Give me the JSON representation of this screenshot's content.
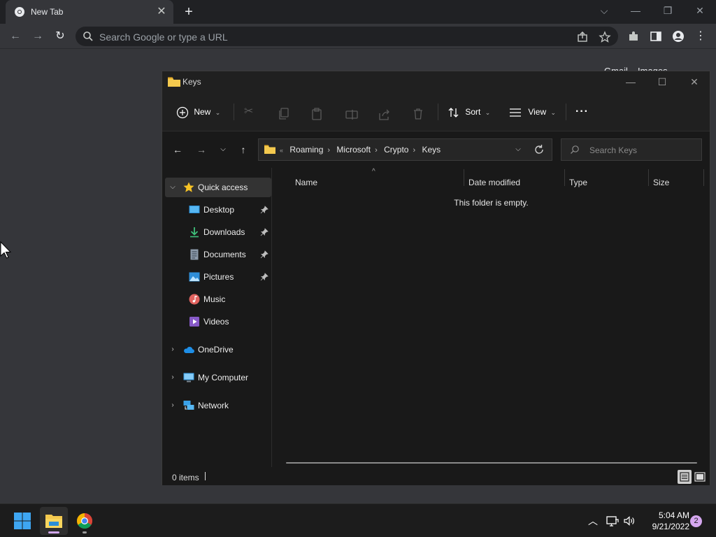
{
  "browser": {
    "tab_title": "New Tab",
    "omnibox_placeholder": "Search Google or type a URL",
    "ntp_links": [
      "Gmail",
      "Images"
    ]
  },
  "explorer": {
    "window_title": "Keys",
    "commands": {
      "new_label": "New",
      "sort_label": "Sort",
      "view_label": "View",
      "more_label": "···"
    },
    "breadcrumb": [
      "Roaming",
      "Microsoft",
      "Crypto",
      "Keys"
    ],
    "breadcrumb_overflow": "«",
    "search_placeholder": "Search Keys",
    "nav": {
      "quick_access": "Quick access",
      "items": [
        {
          "label": "Desktop",
          "pinned": true
        },
        {
          "label": "Downloads",
          "pinned": true
        },
        {
          "label": "Documents",
          "pinned": true
        },
        {
          "label": "Pictures",
          "pinned": true
        },
        {
          "label": "Music",
          "pinned": false
        },
        {
          "label": "Videos",
          "pinned": false
        }
      ],
      "onedrive": "OneDrive",
      "my_computer": "My Computer",
      "network": "Network"
    },
    "columns": [
      "Name",
      "Date modified",
      "Type",
      "Size"
    ],
    "empty_message": "This folder is empty.",
    "status": {
      "item_count": "0 items"
    }
  },
  "taskbar": {
    "time": "5:04 AM",
    "date": "9/21/2022",
    "notification_count": "2"
  },
  "colors": {
    "chrome_frame": "#202124",
    "chrome_toolbar": "#35363a",
    "explorer_bg": "#191919",
    "folder_yellow": "#f4c94e",
    "notification_badge": "#d5a7ef"
  }
}
